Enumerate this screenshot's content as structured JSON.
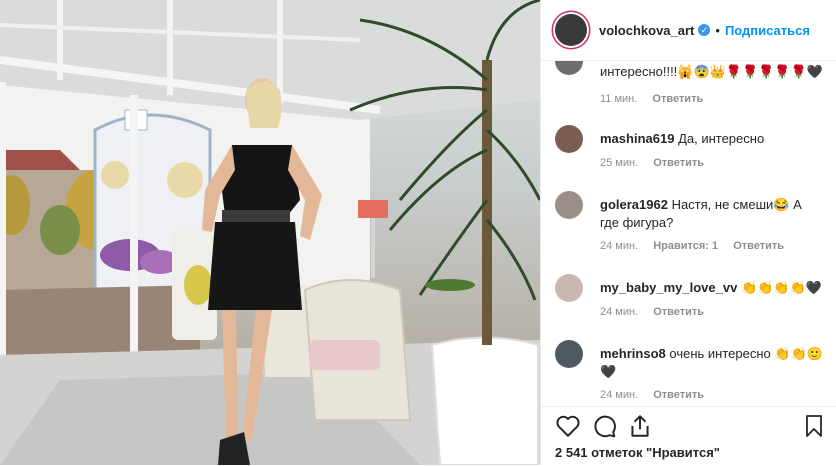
{
  "header": {
    "username": "volochkova_art",
    "verified_icon": "verified-check-icon",
    "separator": "•",
    "follow_label": "Подписаться"
  },
  "comments": [
    {
      "username": "",
      "text": "интересно!!!!🙀😨👑🌹🌹🌹🌹🌹🖤",
      "time": "11 мин.",
      "likes": "",
      "reply": "Ответить"
    },
    {
      "username": "mashina619",
      "text": "Да, интересно",
      "time": "25 мин.",
      "likes": "",
      "reply": "Ответить"
    },
    {
      "username": "golera1962",
      "text": "Настя, не смеши😂 А где фигура?",
      "time": "24 мин.",
      "likes": "Нравится: 1",
      "reply": "Ответить"
    },
    {
      "username": "my_baby_my_love_vv",
      "text": "👏👏👏👏🖤",
      "time": "24 мин.",
      "likes": "",
      "reply": "Ответить"
    },
    {
      "username": "mehrinso8",
      "text": "очень интересно 👏👏🙂🖤",
      "time": "24 мин.",
      "likes": "",
      "reply": "Ответить"
    }
  ],
  "actions": {
    "icons": [
      "heart-icon",
      "comment-icon",
      "share-icon",
      "bookmark-icon"
    ],
    "likes_text": "2 541 отметок \"Нравится\""
  },
  "colors": {
    "accent": "#0095f6",
    "meta": "#8e8e8e",
    "border": "#efefef"
  }
}
